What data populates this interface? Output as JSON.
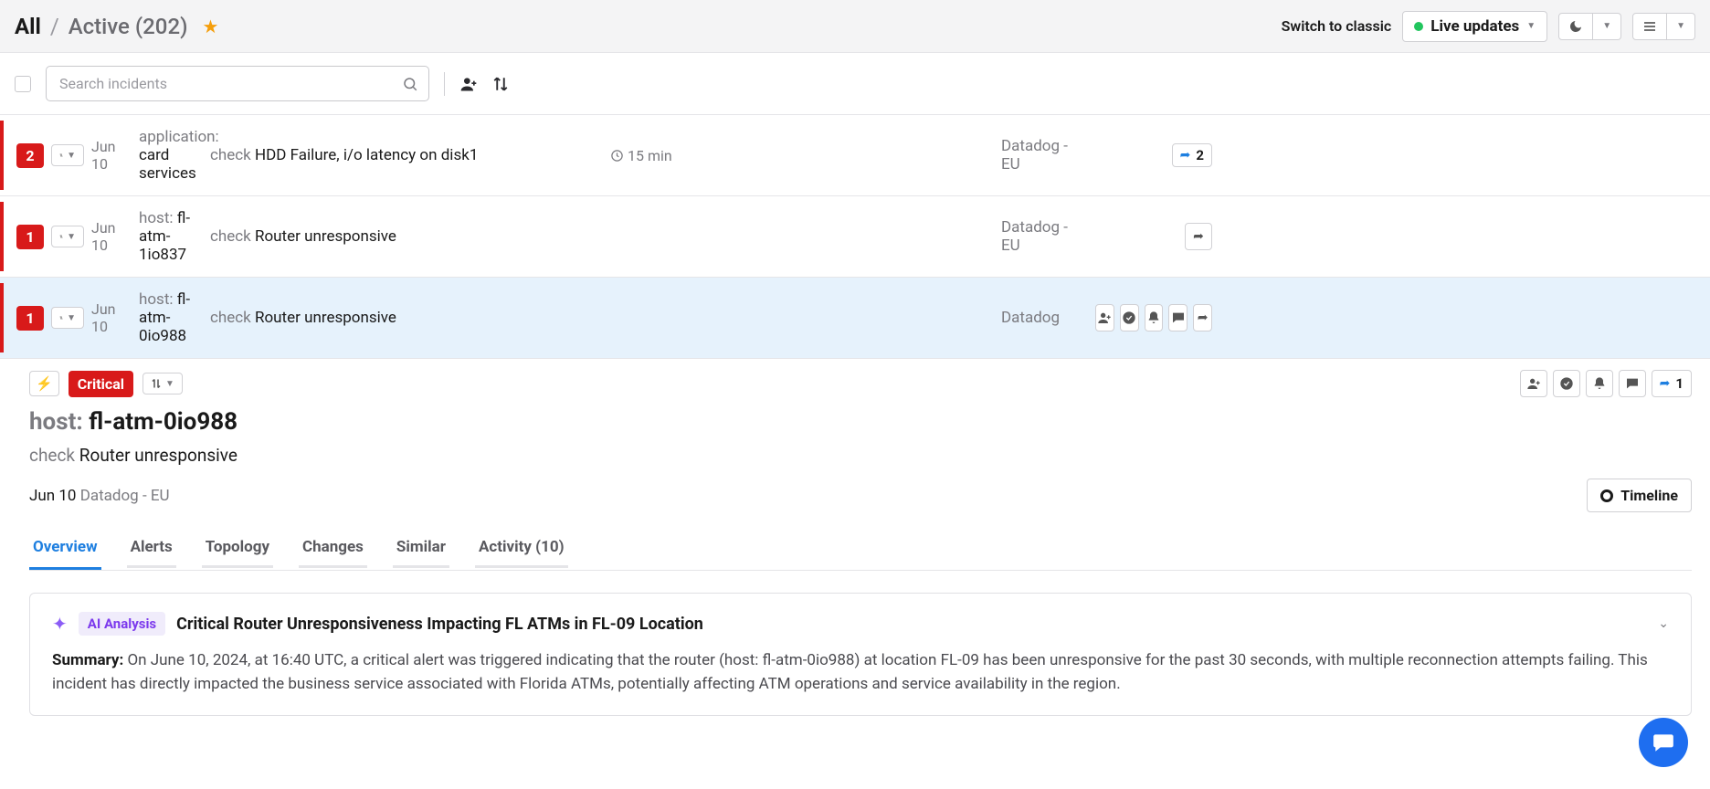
{
  "header": {
    "title_all": "All",
    "title_sub": "Active (202)",
    "switch_classic": "Switch to classic",
    "live_updates": "Live updates"
  },
  "search": {
    "placeholder": "Search incidents"
  },
  "rows": [
    {
      "count": "2",
      "date": "Jun 10",
      "entity_label": "application:",
      "entity_value": "card services",
      "check_label": "check",
      "check_value": "HDD Failure, i/o latency on disk1",
      "duration": "15 min",
      "source": "Datadog - EU",
      "share_count": "2"
    },
    {
      "count": "1",
      "date": "Jun 10",
      "entity_label": "host:",
      "entity_value": "fl-atm-1io837",
      "check_label": "check",
      "check_value": "Router unresponsive",
      "duration": "",
      "source": "Datadog - EU",
      "share_count": ""
    },
    {
      "count": "1",
      "date": "Jun 10",
      "entity_label": "host:",
      "entity_value": "fl-atm-0io988",
      "check_label": "check",
      "check_value": "Router unresponsive",
      "duration": "",
      "source": "Datadog",
      "share_count": ""
    }
  ],
  "detail": {
    "severity": "Critical",
    "title_label": "host:",
    "title_value": "fl-atm-0io988",
    "check_label": "check",
    "check_value": "Router unresponsive",
    "meta_date": "Jun 10",
    "meta_source": "Datadog - EU",
    "timeline": "Timeline",
    "share_count": "1"
  },
  "tabs": {
    "overview": "Overview",
    "alerts": "Alerts",
    "topology": "Topology",
    "changes": "Changes",
    "similar": "Similar",
    "activity": "Activity",
    "activity_count": "(10)"
  },
  "analysis": {
    "pill": "AI Analysis",
    "title": "Critical Router Unresponsiveness Impacting FL ATMs in FL-09 Location",
    "summary_label": "Summary:",
    "summary_text": "On June 10, 2024, at 16:40 UTC, a critical alert was triggered indicating that the router (host: fl-atm-0io988) at location FL-09 has been unresponsive for the past 30 seconds, with multiple reconnection attempts failing. This incident has directly impacted the business service associated with Florida ATMs, potentially affecting ATM operations and service availability in the region."
  }
}
